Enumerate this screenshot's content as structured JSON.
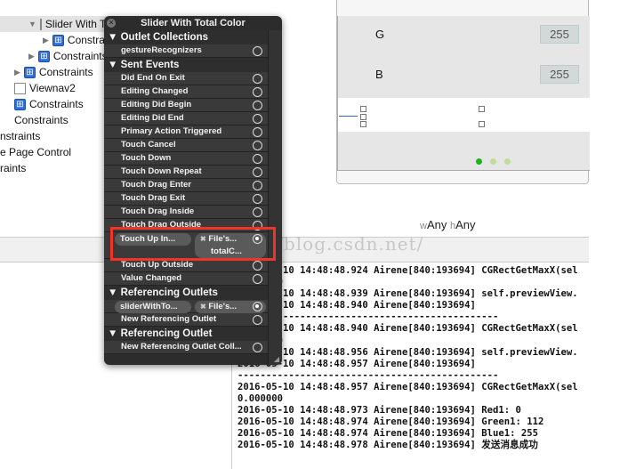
{
  "tree": [
    {
      "label": "Slider With Total Color",
      "icon": "view",
      "indent": 32,
      "expanded": true,
      "selected": true
    },
    {
      "label": "Constraints",
      "icon": "constraints",
      "indent": 48
    },
    {
      "label": "Constraints",
      "icon": "constraints",
      "indent": 32
    },
    {
      "label": "Constraints",
      "icon": "constraints",
      "indent": 16
    },
    {
      "label": "Viewnav2",
      "icon": "view",
      "indent": 16,
      "noarrow": true
    },
    {
      "label": "Constraints",
      "icon": "constraints",
      "indent": 16,
      "noarrow": true
    },
    {
      "label": "Constraints",
      "indent": 16,
      "noarrow": true
    },
    {
      "label": "nstraints",
      "indent": 0,
      "noarrow": true
    },
    {
      "label": "e Page Control",
      "indent": 0,
      "noarrow": true
    },
    {
      "label": "raints",
      "indent": 0,
      "noarrow": true
    }
  ],
  "canvas": {
    "g_label": "G",
    "g_value": "255",
    "b_label": "B",
    "b_value": "255",
    "page_dots": 3,
    "current_page": 1,
    "active_dot_color": "#1ab51a",
    "inactive_dot_color": "#b9df98"
  },
  "size_class": {
    "w_prefix": "w",
    "w_value": "Any",
    "h_prefix": "h",
    "h_value": "Any"
  },
  "watermark": "http://blog.csdn.net/",
  "console": [
    "2016-05-10 14:48:48.924 Airene[840:193694] CGRectGetMaxX(sel",
    "0.000000",
    "2016-05-10 14:48:48.939 Airene[840:193694] self.previewView.",
    "2016-05-10 14:48:48.940 Airene[840:193694]",
    "----------------------------------------------",
    "2016-05-10 14:48:48.940 Airene[840:193694] CGRectGetMaxX(sel",
    "0.000000",
    "2016-05-10 14:48:48.956 Airene[840:193694] self.previewView.",
    "2016-05-10 14:48:48.957 Airene[840:193694]",
    "----------------------------------------------",
    "2016-05-10 14:48:48.957 Airene[840:193694] CGRectGetMaxX(sel",
    "0.000000",
    "2016-05-10 14:48:48.973 Airene[840:193694] Red1: 0",
    "2016-05-10 14:48:48.974 Airene[840:193694] Green1: 112",
    "2016-05-10 14:48:48.974 Airene[840:193694] Blue1: 255",
    "2016-05-10 14:48:48.978 Airene[840:193694] 发送消息成功"
  ],
  "popover": {
    "title": "Slider With Total Color",
    "rows": [
      {
        "type": "header",
        "label": "Outlet Collections"
      },
      {
        "type": "item",
        "label": "gestureRecognizers"
      },
      {
        "type": "header",
        "label": "Sent Events"
      },
      {
        "type": "item",
        "label": "Did End On Exit"
      },
      {
        "type": "item",
        "label": "Editing Changed"
      },
      {
        "type": "item",
        "label": "Editing Did Begin"
      },
      {
        "type": "item",
        "label": "Editing Did End"
      },
      {
        "type": "item",
        "label": "Primary Action Triggered"
      },
      {
        "type": "item",
        "label": "Touch Cancel"
      },
      {
        "type": "item",
        "label": "Touch Down"
      },
      {
        "type": "item",
        "label": "Touch Down Repeat"
      },
      {
        "type": "item",
        "label": "Touch Drag Enter"
      },
      {
        "type": "item",
        "label": "Touch Drag Exit"
      },
      {
        "type": "item",
        "label": "Touch Drag Inside"
      },
      {
        "type": "item",
        "label": "Touch Drag Outside"
      },
      {
        "type": "conn",
        "label": "Touch Up In...",
        "target": "File's...",
        "action": "totalC..."
      },
      {
        "type": "item",
        "label": "Touch Up Outside"
      },
      {
        "type": "item",
        "label": "Value Changed"
      },
      {
        "type": "header",
        "label": "Referencing Outlets"
      },
      {
        "type": "conn1",
        "label": "sliderWithTo...",
        "target": "File's..."
      },
      {
        "type": "item",
        "label": "New Referencing Outlet"
      },
      {
        "type": "header",
        "label": "Referencing Outlet Collections"
      },
      {
        "type": "item",
        "label": "New Referencing Outlet Coll..."
      }
    ]
  },
  "highlight_color": "#f33327"
}
